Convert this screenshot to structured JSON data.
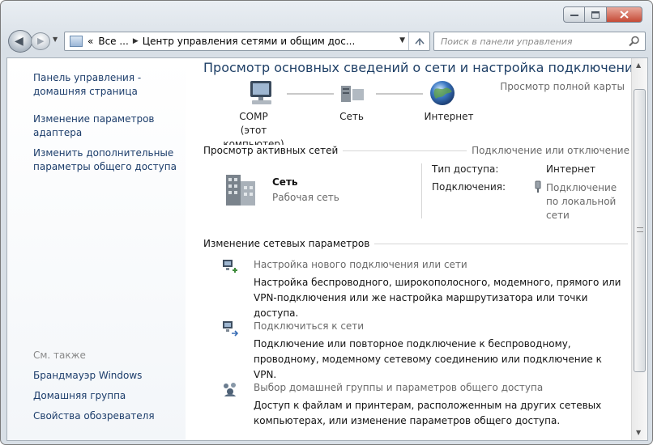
{
  "window": {
    "controls": [
      "minimize",
      "maximize",
      "close"
    ]
  },
  "navigation": {
    "address": {
      "prefix": "«",
      "crumb1": "Все ...",
      "crumb2": "Центр управления сетями и общим дос..."
    },
    "search": {
      "placeholder": "Поиск в панели управления"
    }
  },
  "sidebar": {
    "home_link": "Панель управления - домашняя страница",
    "links": [
      "Изменение параметров адаптера",
      "Изменить дополнительные параметры общего доступа"
    ],
    "see_also_title": "См. также",
    "see_also": [
      "Брандмауэр Windows",
      "Домашняя группа",
      "Свойства обозревателя"
    ]
  },
  "main": {
    "title": "Просмотр основных сведений о сети и настройка подключений",
    "full_map_link": "Просмотр полной карты",
    "map": {
      "computer_name": "COMP",
      "computer_sub": "(этот компьютер)",
      "network": "Сеть",
      "internet": "Интернет"
    },
    "active": {
      "heading": "Просмотр активных сетей",
      "connect_link": "Подключение или отключение",
      "network_name": "Сеть",
      "network_type": "Рабочая сеть",
      "access_label": "Тип доступа:",
      "access_value": "Интернет",
      "connections_label": "Подключения:",
      "connections_value": "Подключение по локальной сети"
    },
    "change": {
      "heading": "Изменение сетевых параметров",
      "tasks": [
        {
          "title": "Настройка нового подключения или сети",
          "description": "Настройка беспроводного, широкополосного, модемного, прямого или VPN-подключения или же настройка маршрутизатора или точки доступа."
        },
        {
          "title": "Подключиться к сети",
          "description": "Подключение или повторное подключение к беспроводному, проводному, модемному сетевому соединению или подключение к VPN."
        },
        {
          "title": "Выбор домашней группы и параметров общего доступа",
          "description": "Доступ к файлам и принтерам, расположенным на других сетевых компьютерах, или изменение параметров общего доступа."
        }
      ]
    }
  }
}
